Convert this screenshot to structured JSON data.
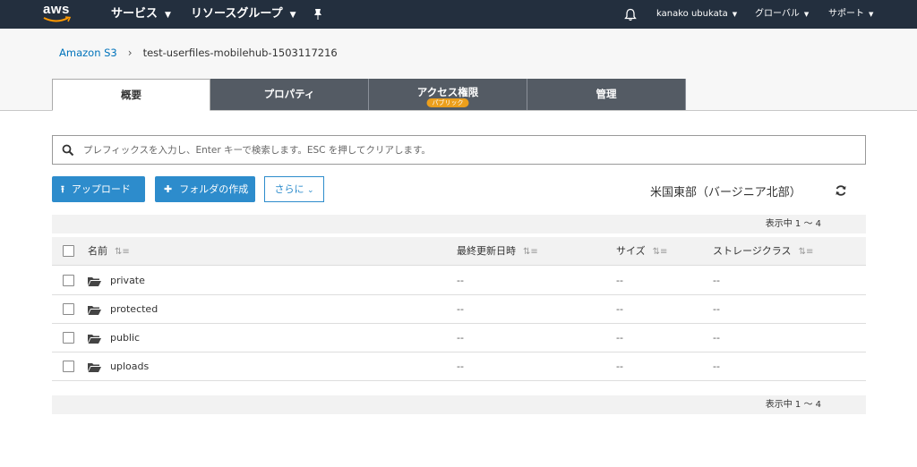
{
  "nav": {
    "logo": "aws",
    "services": "サービス",
    "resource_groups": "リソースグループ",
    "user": "kanako ubukata",
    "region": "グローバル",
    "support": "サポート"
  },
  "breadcrumb": {
    "root": "Amazon S3",
    "current": "test-userfiles-mobilehub-1503117216"
  },
  "tabs": [
    {
      "label": "概要"
    },
    {
      "label": "プロパティ"
    },
    {
      "label": "アクセス権限",
      "badge": "パブリック"
    },
    {
      "label": "管理"
    }
  ],
  "search": {
    "placeholder": "プレフィックスを入力し、Enter キーで検索します。ESC を押してクリアします。",
    "value": ""
  },
  "actions": {
    "upload": "アップロード",
    "create_folder": "フォルダの作成",
    "more": "さらに"
  },
  "bucket_region": "米国東部（バージニア北部）",
  "pager": {
    "top": "表示中 1 ～ 4",
    "bottom": "表示中 1 ～ 4"
  },
  "table": {
    "columns": [
      "名前",
      "最終更新日時",
      "サイズ",
      "ストレージクラス"
    ],
    "rows": [
      {
        "name": "private",
        "modified": "--",
        "size": "--",
        "storage": "--"
      },
      {
        "name": "protected",
        "modified": "--",
        "size": "--",
        "storage": "--"
      },
      {
        "name": "public",
        "modified": "--",
        "size": "--",
        "storage": "--"
      },
      {
        "name": "uploads",
        "modified": "--",
        "size": "--",
        "storage": "--"
      }
    ]
  },
  "colors": {
    "nav_bg": "#232f3e",
    "tab_bg": "#545b64",
    "primary": "#2d8ccc",
    "badge": "#ec9f1c",
    "link": "#0073bb"
  }
}
